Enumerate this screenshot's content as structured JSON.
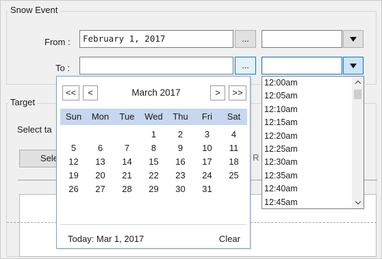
{
  "snow_event": {
    "legend": "Snow Event",
    "from_label": "From :",
    "from_value": "February 1, 2017",
    "to_label": "To :",
    "to_value": "",
    "ellipsis": "..."
  },
  "target": {
    "legend": "Target",
    "select_text": "Select ta",
    "select_button": "Sele",
    "partial_char": "R"
  },
  "calendar": {
    "prev_year": "<<",
    "prev_month": "<",
    "next_month": ">",
    "next_year": ">>",
    "month_year": "March  2017",
    "weekdays": [
      "Sun",
      "Mon",
      "Tue",
      "Wed",
      "Thu",
      "Fri",
      "Sat"
    ],
    "weeks": [
      [
        "",
        "",
        "",
        "1",
        "2",
        "3",
        "4"
      ],
      [
        "5",
        "6",
        "7",
        "8",
        "9",
        "10",
        "11"
      ],
      [
        "12",
        "13",
        "14",
        "15",
        "16",
        "17",
        "18"
      ],
      [
        "19",
        "20",
        "21",
        "22",
        "23",
        "24",
        "25"
      ],
      [
        "26",
        "27",
        "28",
        "29",
        "30",
        "31",
        ""
      ]
    ],
    "today": "Today:  Mar 1, 2017",
    "clear": "Clear"
  },
  "time_dropdown": {
    "items": [
      "12:00am",
      "12:05am",
      "12:10am",
      "12:15am",
      "12:20am",
      "12:25am",
      "12:30am",
      "12:35am",
      "12:40am",
      "12:45am"
    ]
  },
  "icons": {
    "dropdown": "triangle-down-icon",
    "scroll_up": "chevron-up-icon",
    "scroll_down": "chevron-down-icon"
  },
  "colors": {
    "accent": "#0078d7",
    "calendar_header": "#c7d7ee"
  }
}
